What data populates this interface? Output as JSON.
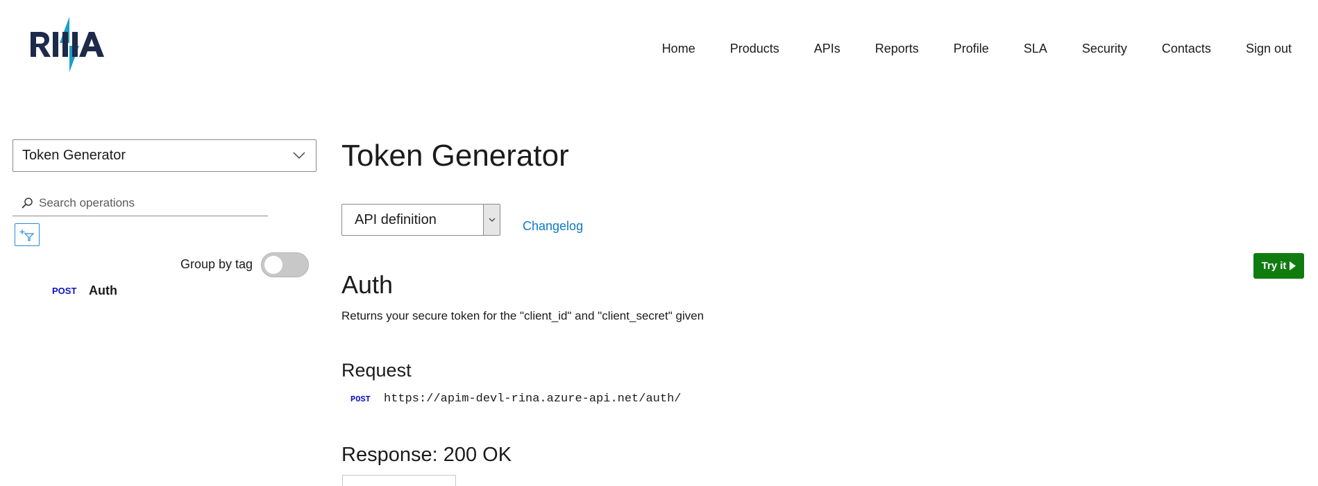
{
  "brand": {
    "logo_text": "RINA",
    "colors": {
      "navy": "#1e2a4a",
      "teal": "#1aa0c8"
    }
  },
  "nav": {
    "items": [
      "Home",
      "Products",
      "APIs",
      "Reports",
      "Profile",
      "SLA",
      "Security",
      "Contacts",
      "Sign out"
    ]
  },
  "sidebar": {
    "api_select_value": "Token Generator",
    "search_placeholder": "Search operations",
    "group_by_tag_label": "Group by tag",
    "group_by_tag_on": false,
    "operations": [
      {
        "method": "POST",
        "name": "Auth"
      }
    ]
  },
  "main": {
    "title": "Token Generator",
    "definition_select_value": "API definition",
    "changelog_label": "Changelog",
    "try_it_label": "Try it",
    "operation": {
      "name": "Auth",
      "description": "Returns your secure token for the \"client_id\" and \"client_secret\" given",
      "request_heading": "Request",
      "request_method": "POST",
      "request_url": "https://apim-devl-rina.azure-api.net/auth/",
      "response_heading": "Response: 200 OK"
    }
  },
  "colors": {
    "accent_link": "#0e78c8",
    "try_button": "#107c10",
    "method_post": "#1010c8"
  }
}
